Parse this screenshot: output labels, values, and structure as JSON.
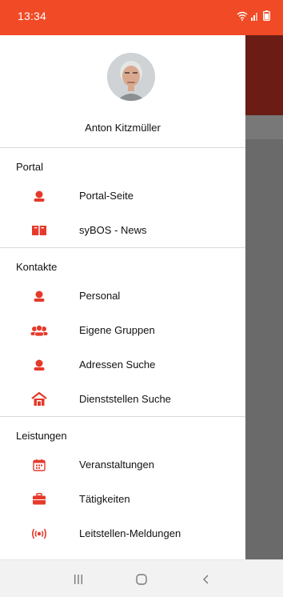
{
  "status_bar": {
    "time": "13:34",
    "background_color": "#f04a26",
    "icons": [
      "wifi-icon",
      "signal-icon",
      "battery-icon"
    ]
  },
  "drawer": {
    "user_name": "Anton Kitzmüller",
    "accent_color": "#e53a2b",
    "sections": [
      {
        "title": "Portal",
        "items": [
          {
            "label": "Portal-Seite",
            "icon": "person-icon"
          },
          {
            "label": "syBOS - News",
            "icon": "book-icon"
          }
        ]
      },
      {
        "title": "Kontakte",
        "items": [
          {
            "label": "Personal",
            "icon": "person-icon"
          },
          {
            "label": "Eigene Gruppen",
            "icon": "group-icon"
          },
          {
            "label": "Adressen Suche",
            "icon": "person-icon"
          },
          {
            "label": "Dienststellen Suche",
            "icon": "building-icon"
          }
        ]
      },
      {
        "title": "Leistungen",
        "items": [
          {
            "label": "Veranstaltungen",
            "icon": "calendar-icon"
          },
          {
            "label": "Tätigkeiten",
            "icon": "briefcase-icon"
          },
          {
            "label": "Leitstellen-Meldungen",
            "icon": "broadcast-icon"
          }
        ]
      }
    ]
  },
  "nav_bar": {
    "buttons": [
      "recents-button",
      "home-button",
      "back-button"
    ]
  }
}
